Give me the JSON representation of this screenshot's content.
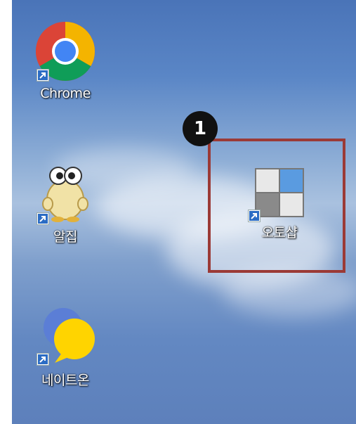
{
  "desktop": {
    "icons": [
      {
        "label": "Chrome",
        "icon": "chrome-icon"
      },
      {
        "label": "알집",
        "icon": "alzip-icon"
      },
      {
        "label": "오토샵",
        "icon": "autoshop-icon"
      },
      {
        "label": "네이트온",
        "icon": "nateon-icon"
      }
    ]
  },
  "annotation": {
    "step_number": "1"
  },
  "colors": {
    "highlight_border": "#9b3a36",
    "badge_bg": "#111111"
  }
}
